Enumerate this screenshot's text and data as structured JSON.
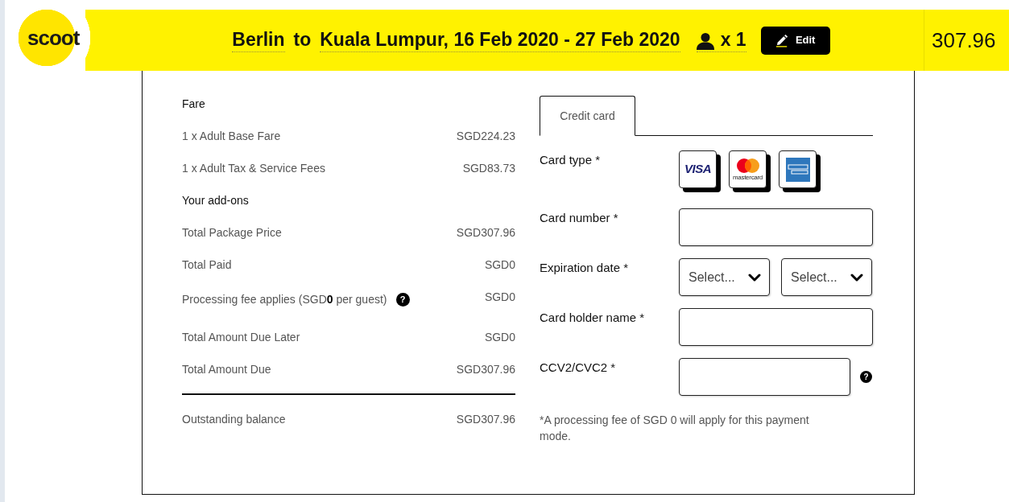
{
  "header": {
    "logo": "scoot",
    "origin": "Berlin",
    "connector": "to",
    "destination_dates": "Kuala Lumpur, 16 Feb 2020 - 27 Feb 2020",
    "passengers": "x 1",
    "edit_button": "Edit",
    "total": "307.96"
  },
  "summary": {
    "rows": [
      {
        "kind": "heading",
        "label": "Fare"
      },
      {
        "kind": "item",
        "label": "1 x Adult Base Fare",
        "amount": "SGD224.23"
      },
      {
        "kind": "item",
        "label": "1 x Adult Tax & Service Fees",
        "amount": "SGD83.73"
      },
      {
        "kind": "heading",
        "label": "Your add-ons"
      },
      {
        "kind": "item",
        "label": "Total Package Price",
        "amount": "SGD307.96"
      },
      {
        "kind": "item",
        "label": "Total Paid",
        "amount": "SGD0"
      },
      {
        "kind": "item",
        "label": "Processing fee applies (SGD**0** per guest)",
        "amount": "SGD0",
        "help": "?"
      },
      {
        "kind": "item",
        "label": "Total Amount Due Later",
        "amount": "SGD0"
      },
      {
        "kind": "item",
        "label": "Total Amount Due",
        "amount": "SGD307.96"
      }
    ],
    "balance": {
      "label": "Outstanding balance",
      "amount": "SGD307.96"
    }
  },
  "payment": {
    "tabs": [
      {
        "label": "Credit card",
        "selected": true
      }
    ],
    "fields": [
      {
        "kind": "card_type",
        "label": "Card type *",
        "cards": [
          {
            "kind": "visa",
            "text": "VISA"
          },
          {
            "kind": "mastercard",
            "text": "mastercard"
          },
          {
            "kind": "amex"
          }
        ]
      },
      {
        "kind": "input",
        "label": "Card number *"
      },
      {
        "kind": "selects",
        "label": "Expiration date *",
        "values": [
          "Select...",
          "Select..."
        ]
      },
      {
        "kind": "input",
        "label": "Card holder name *"
      },
      {
        "kind": "input",
        "label": "CCV2/CVC2 *",
        "help": "?"
      }
    ],
    "note": "*A processing fee of SGD 0 will apply for this payment mode."
  }
}
